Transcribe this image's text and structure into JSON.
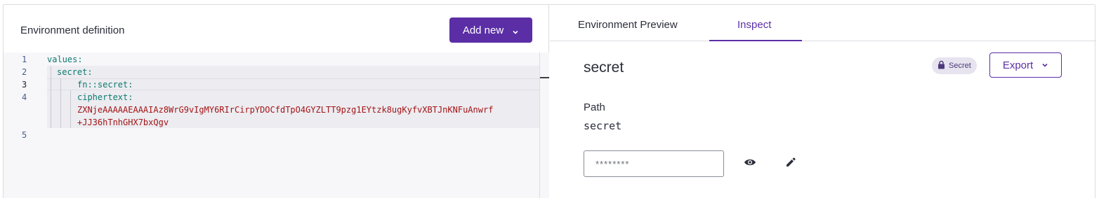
{
  "left": {
    "title": "Environment definition",
    "add_button_label": "Add new"
  },
  "editor": {
    "line_numbers": [
      "1",
      "2",
      "3",
      "4",
      "5"
    ],
    "lines": {
      "l1": "values:",
      "l2": "secret:",
      "l3": "fn::secret:",
      "l4": "ciphertext:",
      "l4_cipher_a": "ZXNjeAAAAAEAAAIAz8WrG9vIgMY6RIrCirpYDOCfdTpO4GYZLTT9pzg1EYtzk8ugKyfvXBTJnKNFuAnwrf",
      "l4_cipher_b": "+JJ36hTnhGHX7bxQgv"
    }
  },
  "right": {
    "tabs": [
      "Environment Preview",
      "Inspect"
    ],
    "active_tab": "Inspect",
    "secret_title": "secret",
    "badge_label": "Secret",
    "export_label": "Export",
    "path_label": "Path",
    "path_value": "secret",
    "secret_field_value": "********"
  },
  "colors": {
    "accent": "#5b2ea6",
    "key_text": "#0e7a6e",
    "cipher_text": "#a31515"
  },
  "icons": [
    "chevron-down-icon",
    "lock-icon",
    "eye-icon",
    "pencil-icon"
  ]
}
